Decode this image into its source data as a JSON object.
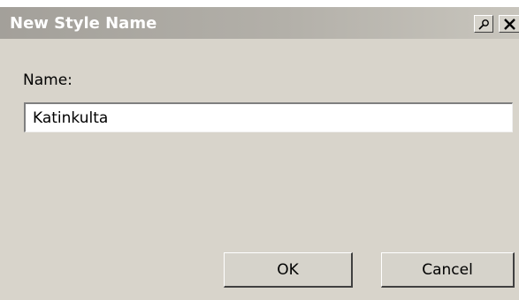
{
  "dialog": {
    "title": "New Style Name",
    "name_label": "Name:",
    "name_value": "Katinkulta",
    "ok_label": "OK",
    "cancel_label": "Cancel"
  },
  "icons": {
    "pin": "pin-icon",
    "close": "close-icon"
  },
  "colors": {
    "titlebar": "#a3a09a",
    "dialog_bg": "#d8d4cb",
    "title_text": "#ffffff"
  }
}
